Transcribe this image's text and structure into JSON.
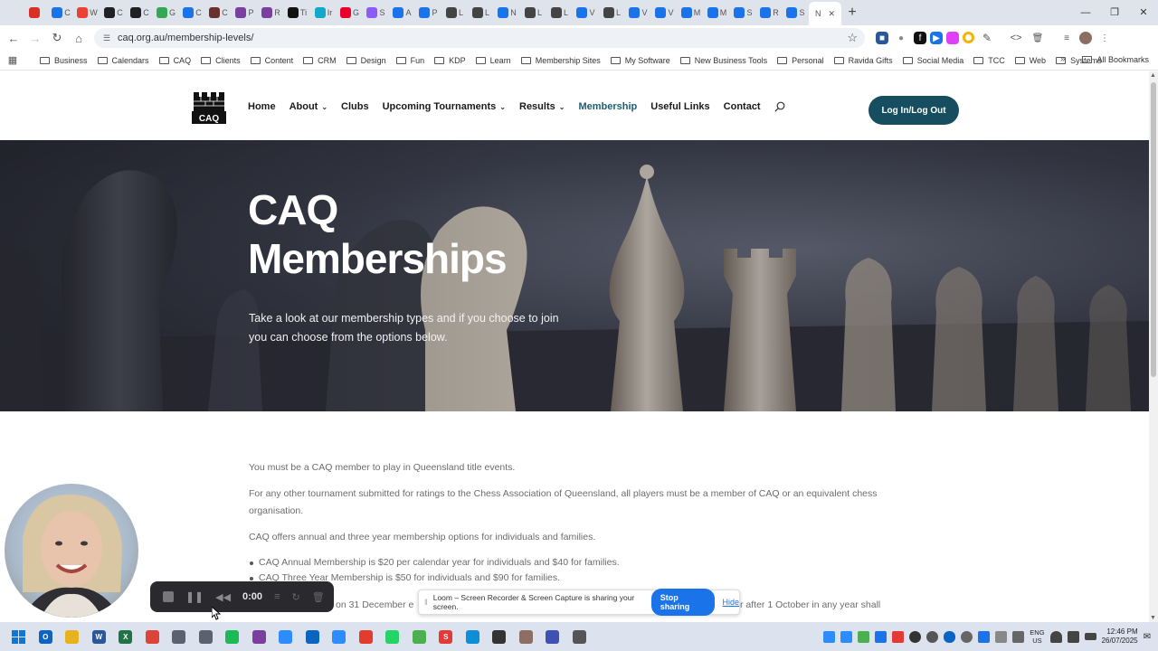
{
  "browser": {
    "url": "caq.org.au/membership-levels/",
    "tabs": [
      {
        "label": "",
        "color": "#d93025"
      },
      {
        "label": "C",
        "color": "#1a73e8"
      },
      {
        "label": "W",
        "color": "#ea4335"
      },
      {
        "label": "C",
        "color": "#202124"
      },
      {
        "label": "C",
        "color": "#202124"
      },
      {
        "label": "G",
        "color": "#34a853"
      },
      {
        "label": "C",
        "color": "#1a73e8"
      },
      {
        "label": "C",
        "color": "#6b2f2f"
      },
      {
        "label": "P",
        "color": "#7b3fa0"
      },
      {
        "label": "R",
        "color": "#7b3fa0"
      },
      {
        "label": "Ti",
        "color": "#111111"
      },
      {
        "label": "Ir",
        "color": "#12a8c9"
      },
      {
        "label": "G",
        "color": "#ea0029"
      },
      {
        "label": "S",
        "color": "#8b5cf6"
      },
      {
        "label": "A",
        "color": "#1a73e8"
      },
      {
        "label": "P",
        "color": "#1a73e8"
      },
      {
        "label": "L",
        "color": "#444444"
      },
      {
        "label": "L",
        "color": "#444444"
      },
      {
        "label": "N",
        "color": "#1a73e8"
      },
      {
        "label": "L",
        "color": "#444444"
      },
      {
        "label": "L",
        "color": "#444444"
      },
      {
        "label": "V",
        "color": "#1a73e8"
      },
      {
        "label": "L",
        "color": "#444444"
      },
      {
        "label": "V",
        "color": "#1a73e8"
      },
      {
        "label": "V",
        "color": "#1a73e8"
      },
      {
        "label": "M",
        "color": "#1a73e8"
      },
      {
        "label": "M",
        "color": "#1a73e8"
      },
      {
        "label": "S",
        "color": "#1a73e8"
      },
      {
        "label": "R",
        "color": "#1a73e8"
      },
      {
        "label": "S",
        "color": "#1a73e8"
      }
    ],
    "active_tab": {
      "label": "N"
    },
    "bookmarks": [
      "Business",
      "Calendars",
      "CAQ",
      "Clients",
      "Content",
      "CRM",
      "Design",
      "Fun",
      "KDP",
      "Learn",
      "Membership Sites",
      "My Software",
      "New Business Tools",
      "Personal",
      "Ravida Gifts",
      "Social Media",
      "TCC",
      "Web",
      "Systems"
    ],
    "all_bookmarks": "All Bookmarks"
  },
  "site": {
    "logo_text": "CAQ",
    "nav": [
      {
        "label": "Home",
        "dropdown": false,
        "active": false
      },
      {
        "label": "About",
        "dropdown": true,
        "active": false
      },
      {
        "label": "Clubs",
        "dropdown": false,
        "active": false
      },
      {
        "label": "Upcoming Tournaments",
        "dropdown": true,
        "active": false
      },
      {
        "label": "Results",
        "dropdown": true,
        "active": false
      },
      {
        "label": "Membership",
        "dropdown": false,
        "active": true
      },
      {
        "label": "Useful Links",
        "dropdown": false,
        "active": false
      },
      {
        "label": "Contact",
        "dropdown": false,
        "active": false
      }
    ],
    "login_label": "Log In/Log Out",
    "accent": "#164e5f"
  },
  "hero": {
    "title_line1": "CAQ",
    "title_line2": "Memberships",
    "subtitle": "Take a look at our membership types and if you choose to join you can choose from the options below."
  },
  "content": {
    "p1": "You must be a CAQ member to play in Queensland title events.",
    "p2": "For any other tournament submitted for ratings to the Chess Association of Queensland, all players must be a member of CAQ or an equivalent chess organisation.",
    "p3": "CAQ offers annual and three year membership options for individuals and families.",
    "bullets": [
      "CAQ Annual Membership is $20 per calendar year for individuals and $40 for families.",
      "CAQ Three Year Membership is $50 for individuals and $90 for families."
    ],
    "partial_left": "on 31 December e",
    "partial_right": "r after 1 October in any year shall"
  },
  "loom": {
    "timer": "0:00",
    "share_text": "Loom – Screen Recorder & Screen Capture is sharing your screen.",
    "stop_label": "Stop sharing",
    "hide_label": "Hide"
  },
  "taskbar": {
    "apps": [
      {
        "name": "outlook",
        "color": "#0a64c2",
        "glyph": "O"
      },
      {
        "name": "file-explorer",
        "color": "#e8b21e",
        "glyph": ""
      },
      {
        "name": "word",
        "color": "#2b579a",
        "glyph": "W"
      },
      {
        "name": "excel",
        "color": "#217346",
        "glyph": "X"
      },
      {
        "name": "chrome",
        "color": "#db4437",
        "glyph": ""
      },
      {
        "name": "calculator",
        "color": "#5a6270",
        "glyph": ""
      },
      {
        "name": "printer",
        "color": "#5a6270",
        "glyph": ""
      },
      {
        "name": "spotify",
        "color": "#1db954",
        "glyph": ""
      },
      {
        "name": "app-purple",
        "color": "#7b3fa0",
        "glyph": ""
      },
      {
        "name": "zoom",
        "color": "#2d8cff",
        "glyph": ""
      },
      {
        "name": "app-blue-arrow",
        "color": "#0a64c2",
        "glyph": ""
      },
      {
        "name": "app-pinwheel",
        "color": "#2d8cff",
        "glyph": ""
      },
      {
        "name": "app-red",
        "color": "#e33b2e",
        "glyph": ""
      },
      {
        "name": "whatsapp",
        "color": "#25d366",
        "glyph": ""
      },
      {
        "name": "app-green-doc",
        "color": "#4caf50",
        "glyph": ""
      },
      {
        "name": "app-s-red",
        "color": "#e53935",
        "glyph": "S"
      },
      {
        "name": "edge",
        "color": "#0c8ed8",
        "glyph": ""
      },
      {
        "name": "app-circle",
        "color": "#333333",
        "glyph": ""
      },
      {
        "name": "app-grid",
        "color": "#8d6e63",
        "glyph": ""
      },
      {
        "name": "app-blue-circle",
        "color": "#3f51b5",
        "glyph": ""
      },
      {
        "name": "app-gear",
        "color": "#555555",
        "glyph": ""
      }
    ],
    "lang_line1": "ENG",
    "lang_line2": "US",
    "time": "12:46 PM",
    "date": "26/07/2025"
  }
}
